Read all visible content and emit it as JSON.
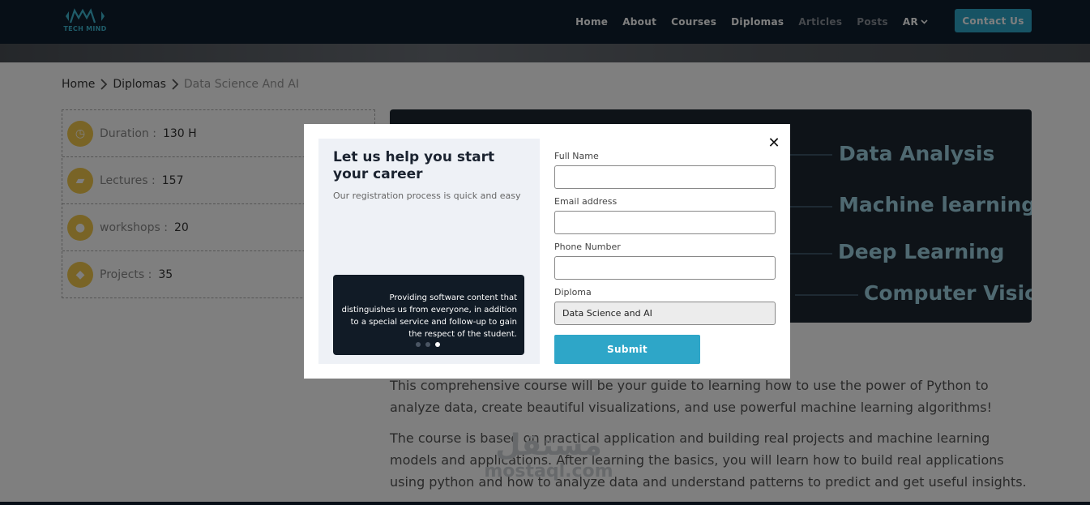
{
  "brand": {
    "logo_text": "TECH MIND"
  },
  "nav": {
    "items": [
      {
        "label": "Home",
        "muted": false
      },
      {
        "label": "About",
        "muted": false
      },
      {
        "label": "Courses",
        "muted": false
      },
      {
        "label": "Diplomas",
        "muted": false
      },
      {
        "label": "Articles",
        "muted": true
      },
      {
        "label": "Posts",
        "muted": true
      }
    ],
    "lang": "AR",
    "contact": "Contact Us"
  },
  "breadcrumb": {
    "home": "Home",
    "section": "Diplomas",
    "current": "Data Science And AI"
  },
  "stats": [
    {
      "label": "Duration :",
      "value": "130 H",
      "icon": "clock-icon"
    },
    {
      "label": "Lectures :",
      "value": "157",
      "icon": "folder-icon"
    },
    {
      "label": "workshops :",
      "value": "20",
      "icon": "users-icon"
    },
    {
      "label": "Projects :",
      "value": "35",
      "icon": "project-icon"
    }
  ],
  "course_image": {
    "topics": [
      "Data Analysis",
      "Machine learning",
      "Deep Learning",
      "Computer Vision"
    ]
  },
  "description": {
    "p1": "This comprehensive course will be your guide to learning how to use the power of Python to analyze data, create beautiful visualizations, and use powerful machine learning algorithms!",
    "p2": "The course is based on practical application and building real projects and machine learning models and applications. After learning the basics, you will learn how to build real applications using python and how to analyze data and understand patterns to predict and get useful insights."
  },
  "watermark": {
    "arabic": "مستقل",
    "latin": "mostaql.com"
  },
  "modal": {
    "title": "Let us help you start your career",
    "subtitle": "Our registration process is quick and easy",
    "slide_text": "Providing software content that distinguishes us from everyone, in addition to a special service and follow-up to gain the respect of the student.",
    "slides_total": 3,
    "active_slide": 3,
    "close_symbol": "✕",
    "form": {
      "full_name_label": "Full Name",
      "email_label": "Email address",
      "phone_label": "Phone Number",
      "diploma_label": "Diploma",
      "diploma_value": "Data Science and AI",
      "submit": "Submit"
    }
  },
  "colors": {
    "navbar": "#0f1f2e",
    "accent": "#2ea6c8",
    "stat_icon": "#f2c94c",
    "slide_bg": "#111b26"
  }
}
